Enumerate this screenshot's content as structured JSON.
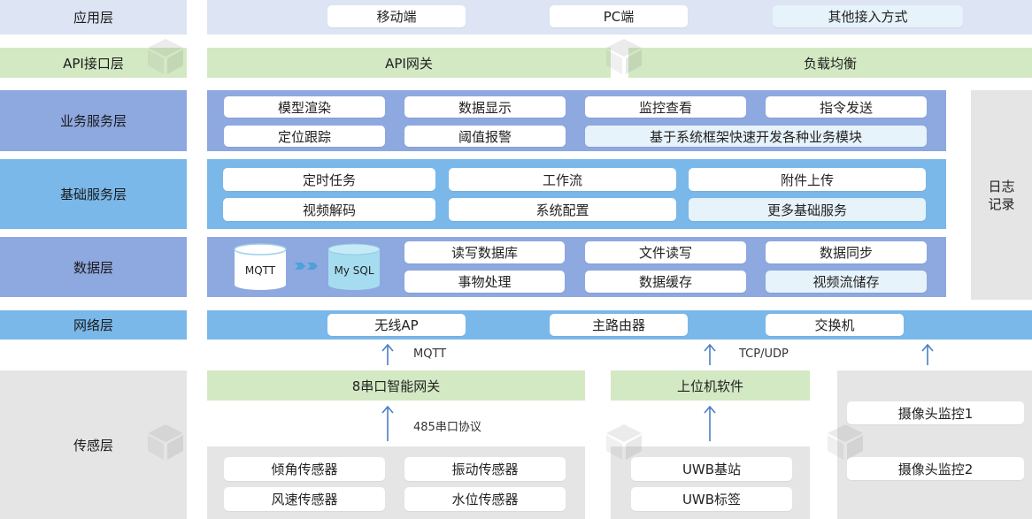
{
  "layers": {
    "app": "应用层",
    "api": "API接口层",
    "biz": "业务服务层",
    "base": "基础服务层",
    "data": "数据层",
    "net": "网络层",
    "sense": "传感层"
  },
  "app_items": [
    "移动端",
    "PC端",
    "其他接入方式"
  ],
  "api_items": [
    "API网关",
    "负载均衡"
  ],
  "biz_items": [
    "模型渲染",
    "数据显示",
    "监控查看",
    "指令发送",
    "定位跟踪",
    "阈值报警",
    "基于系统框架快速开发各种业务模块"
  ],
  "base_items": [
    "定时任务",
    "工作流",
    "附件上传",
    "视频解码",
    "系统配置",
    "更多基础服务"
  ],
  "data_items": [
    "读写数据库",
    "文件读写",
    "数据同步",
    "事物处理",
    "数据缓存",
    "视频流储存"
  ],
  "db": {
    "mqtt": "MQTT",
    "mysql": "My SQL"
  },
  "net_items": [
    "无线AP",
    "主路由器",
    "交换机"
  ],
  "log": "日志\n记录",
  "arrows": {
    "mqtt": "MQTT",
    "tcp": "TCP/UDP",
    "rs485": "485串口协议"
  },
  "gateway": "8串口智能网关",
  "host_software": "上位机软件",
  "sensors": [
    "倾角传感器",
    "振动传感器",
    "风速传感器",
    "水位传感器"
  ],
  "uwb": [
    "UWB基站",
    "UWB标签"
  ],
  "cameras": [
    "摄像头监控1",
    "摄像头监控2"
  ],
  "colors": {
    "app": "#dde4f3",
    "api": "#d3e9c3",
    "biz": "#8ea8e0",
    "base": "#7ab8ea",
    "data": "#8ea8e0",
    "net": "#7ab8ea",
    "sense": "#e5e5e5",
    "green": "#d3e9c3",
    "arrow": "#4a7fc4"
  }
}
